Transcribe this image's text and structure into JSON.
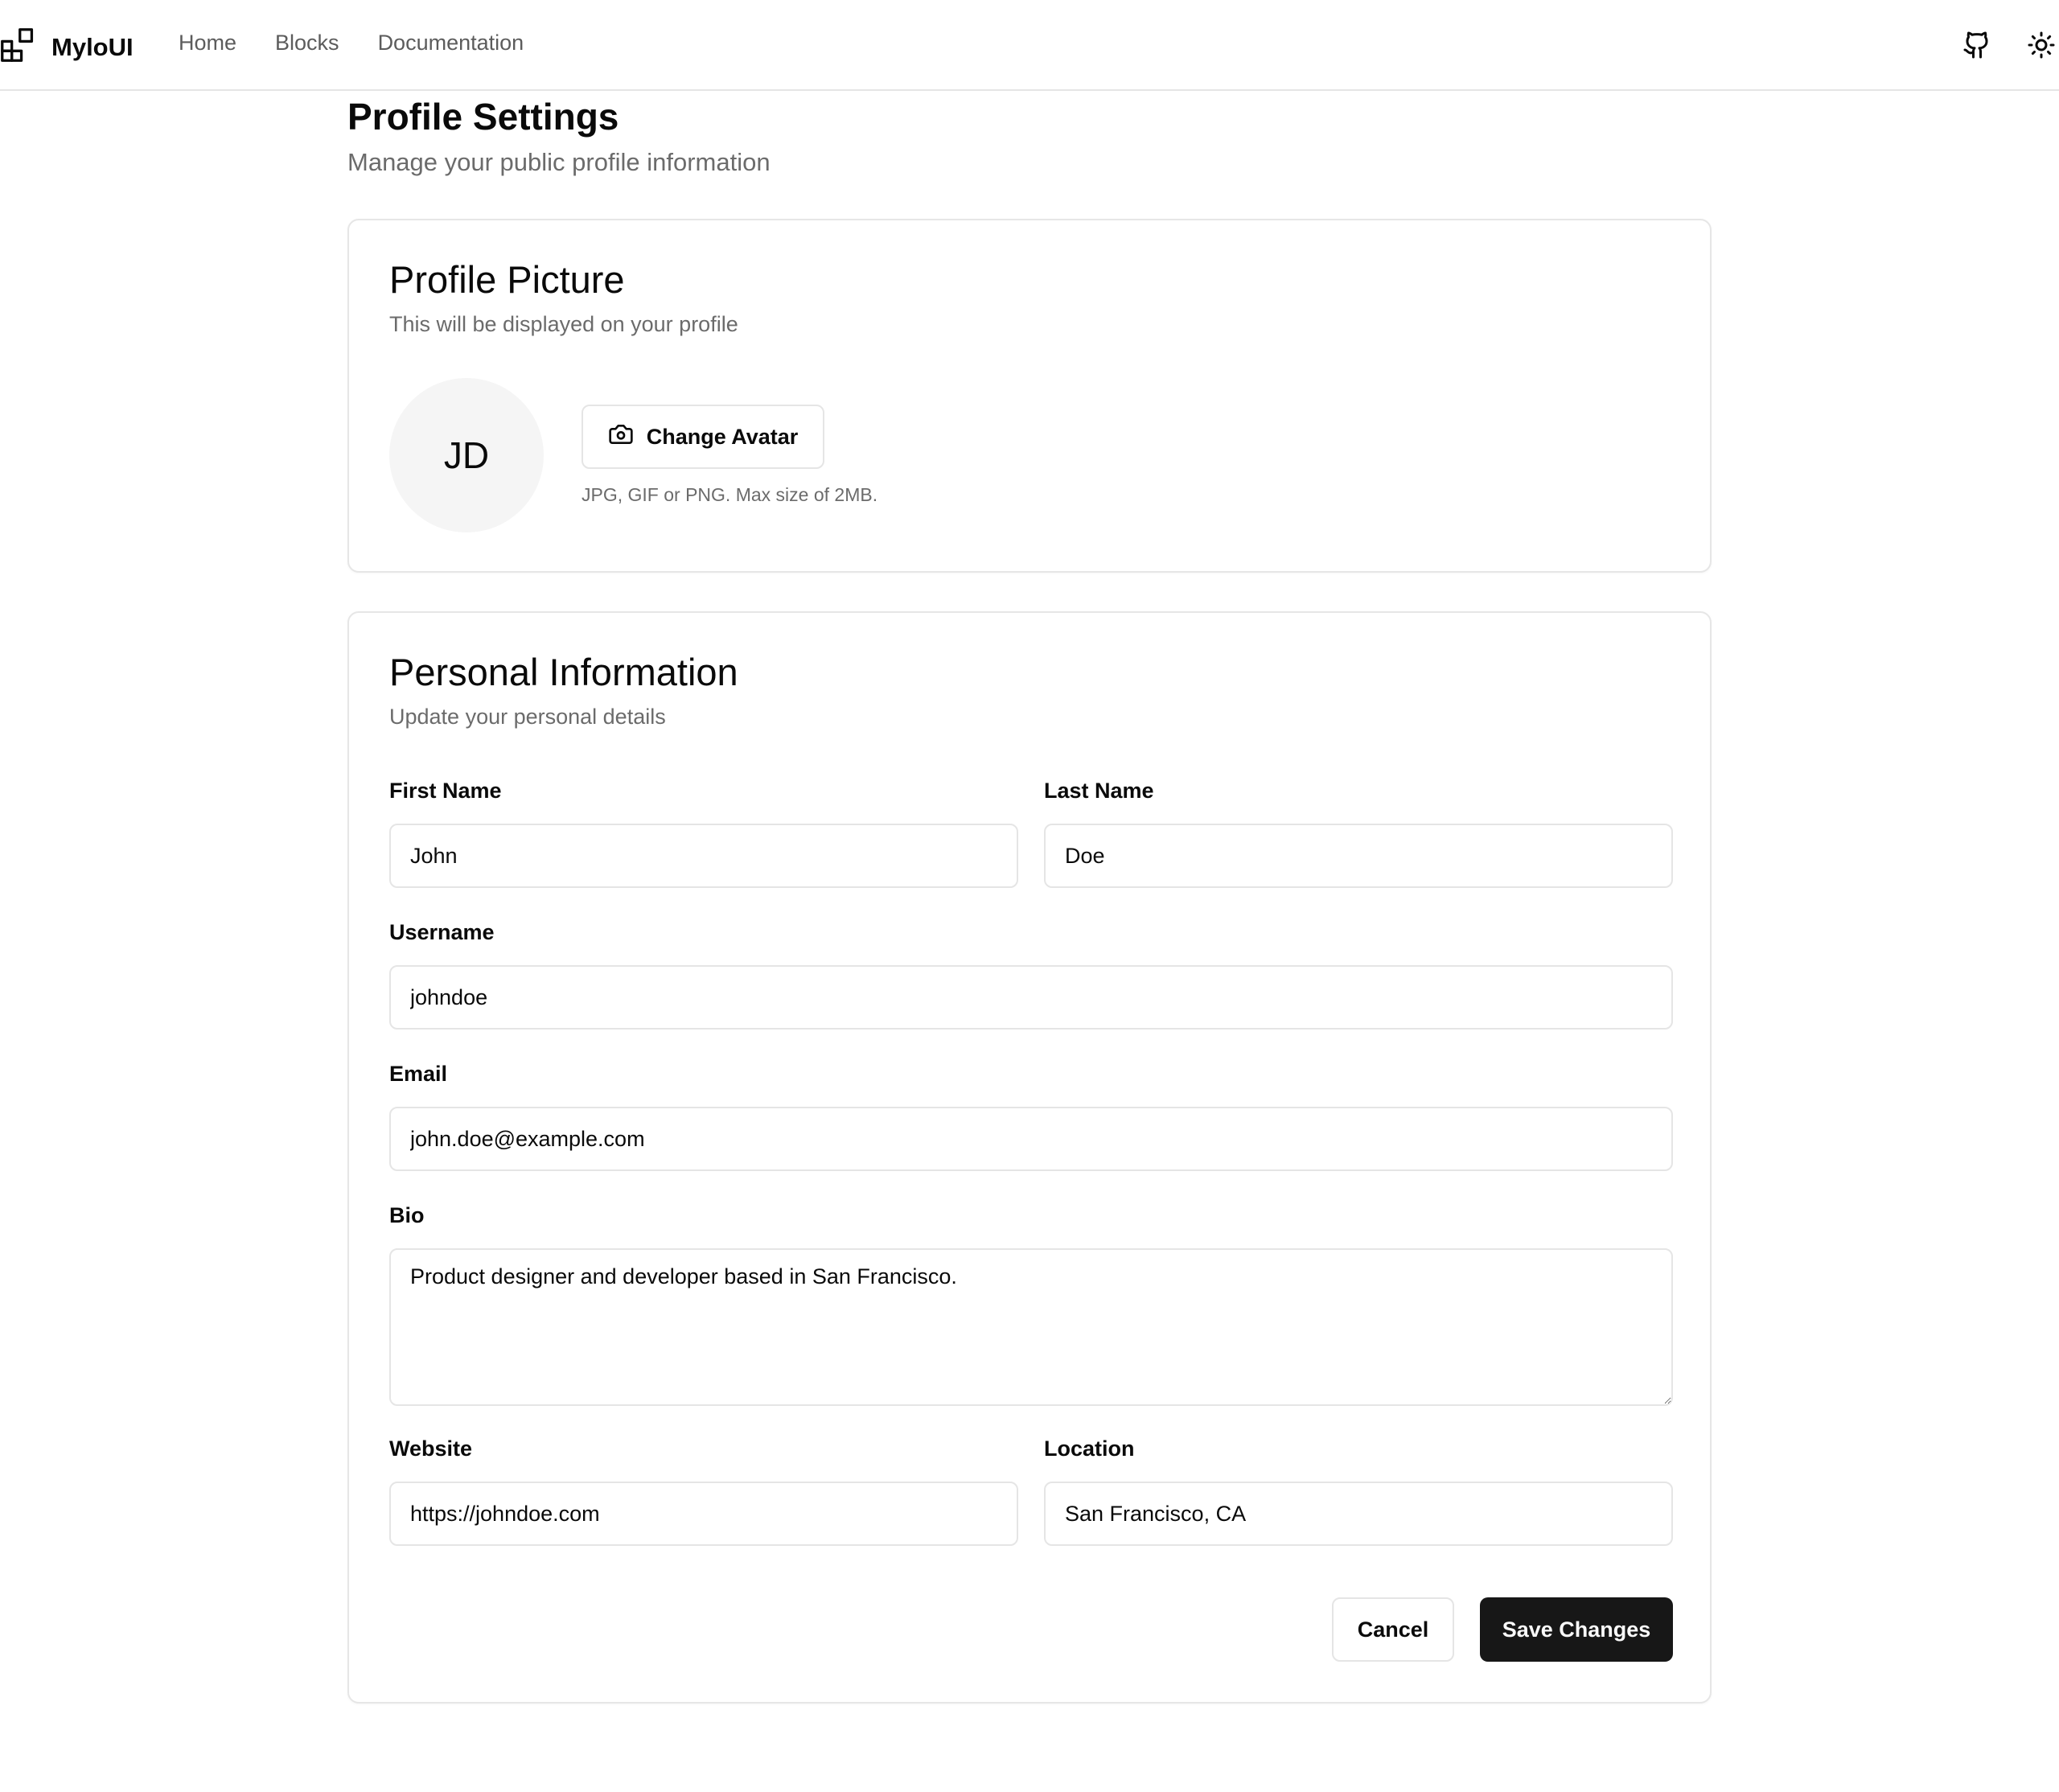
{
  "header": {
    "brand": "MyloUI",
    "nav": [
      {
        "label": "Home"
      },
      {
        "label": "Blocks"
      },
      {
        "label": "Documentation"
      }
    ],
    "icons": [
      "github-icon",
      "sun-icon"
    ]
  },
  "page": {
    "title": "Profile Settings",
    "subtitle": "Manage your public profile information"
  },
  "profile_picture": {
    "title": "Profile Picture",
    "subtitle": "This will be displayed on your profile",
    "initials": "JD",
    "change_button": "Change Avatar",
    "hint": "JPG, GIF or PNG. Max size of 2MB."
  },
  "personal_info": {
    "title": "Personal Information",
    "subtitle": "Update your personal details",
    "fields": {
      "first_name": {
        "label": "First Name",
        "value": "John"
      },
      "last_name": {
        "label": "Last Name",
        "value": "Doe"
      },
      "username": {
        "label": "Username",
        "value": "johndoe"
      },
      "email": {
        "label": "Email",
        "value": "john.doe@example.com"
      },
      "bio": {
        "label": "Bio",
        "value": "Product designer and developer based in San Francisco."
      },
      "website": {
        "label": "Website",
        "value": "https://johndoe.com"
      },
      "location": {
        "label": "Location",
        "value": "San Francisco, CA"
      }
    },
    "cancel_label": "Cancel",
    "save_label": "Save Changes"
  },
  "colors": {
    "primary_button": "#171717",
    "border": "#e5e5e5",
    "muted_text": "#6b6b6b"
  }
}
